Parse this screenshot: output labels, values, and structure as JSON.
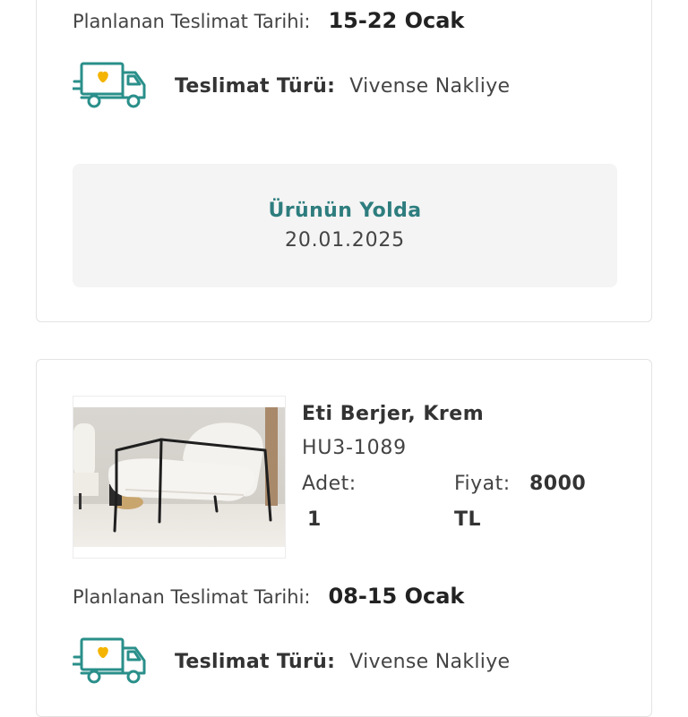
{
  "colors": {
    "accent_teal": "#2e7d7e",
    "truck_stroke": "#2a8f8a",
    "heart": "#f4b400",
    "status_bg": "#f4f4f4"
  },
  "order_item_1": {
    "planned_delivery_label": "Planlanan Teslimat Tarihi:",
    "planned_delivery_value": "15-22 Ocak",
    "delivery_icon": "delivery-truck-heart-icon",
    "delivery_type_label": "Teslimat Türü:",
    "delivery_type_value": "Vivense Nakliye",
    "status_title": "Ürünün Yolda",
    "status_date": "20.01.2025"
  },
  "order_item_2": {
    "product_name": "Eti Berjer, Krem",
    "product_sku": "HU3-1089",
    "quantity_label": "Adet:",
    "quantity_value": "1",
    "price_label": "Fiyat:",
    "price_value": "8000",
    "price_currency": "TL",
    "planned_delivery_label": "Planlanan Teslimat Tarihi:",
    "planned_delivery_value": "08-15 Ocak",
    "delivery_icon": "delivery-truck-heart-icon",
    "delivery_type_label": "Teslimat Türü:",
    "delivery_type_value": "Vivense Nakliye"
  }
}
